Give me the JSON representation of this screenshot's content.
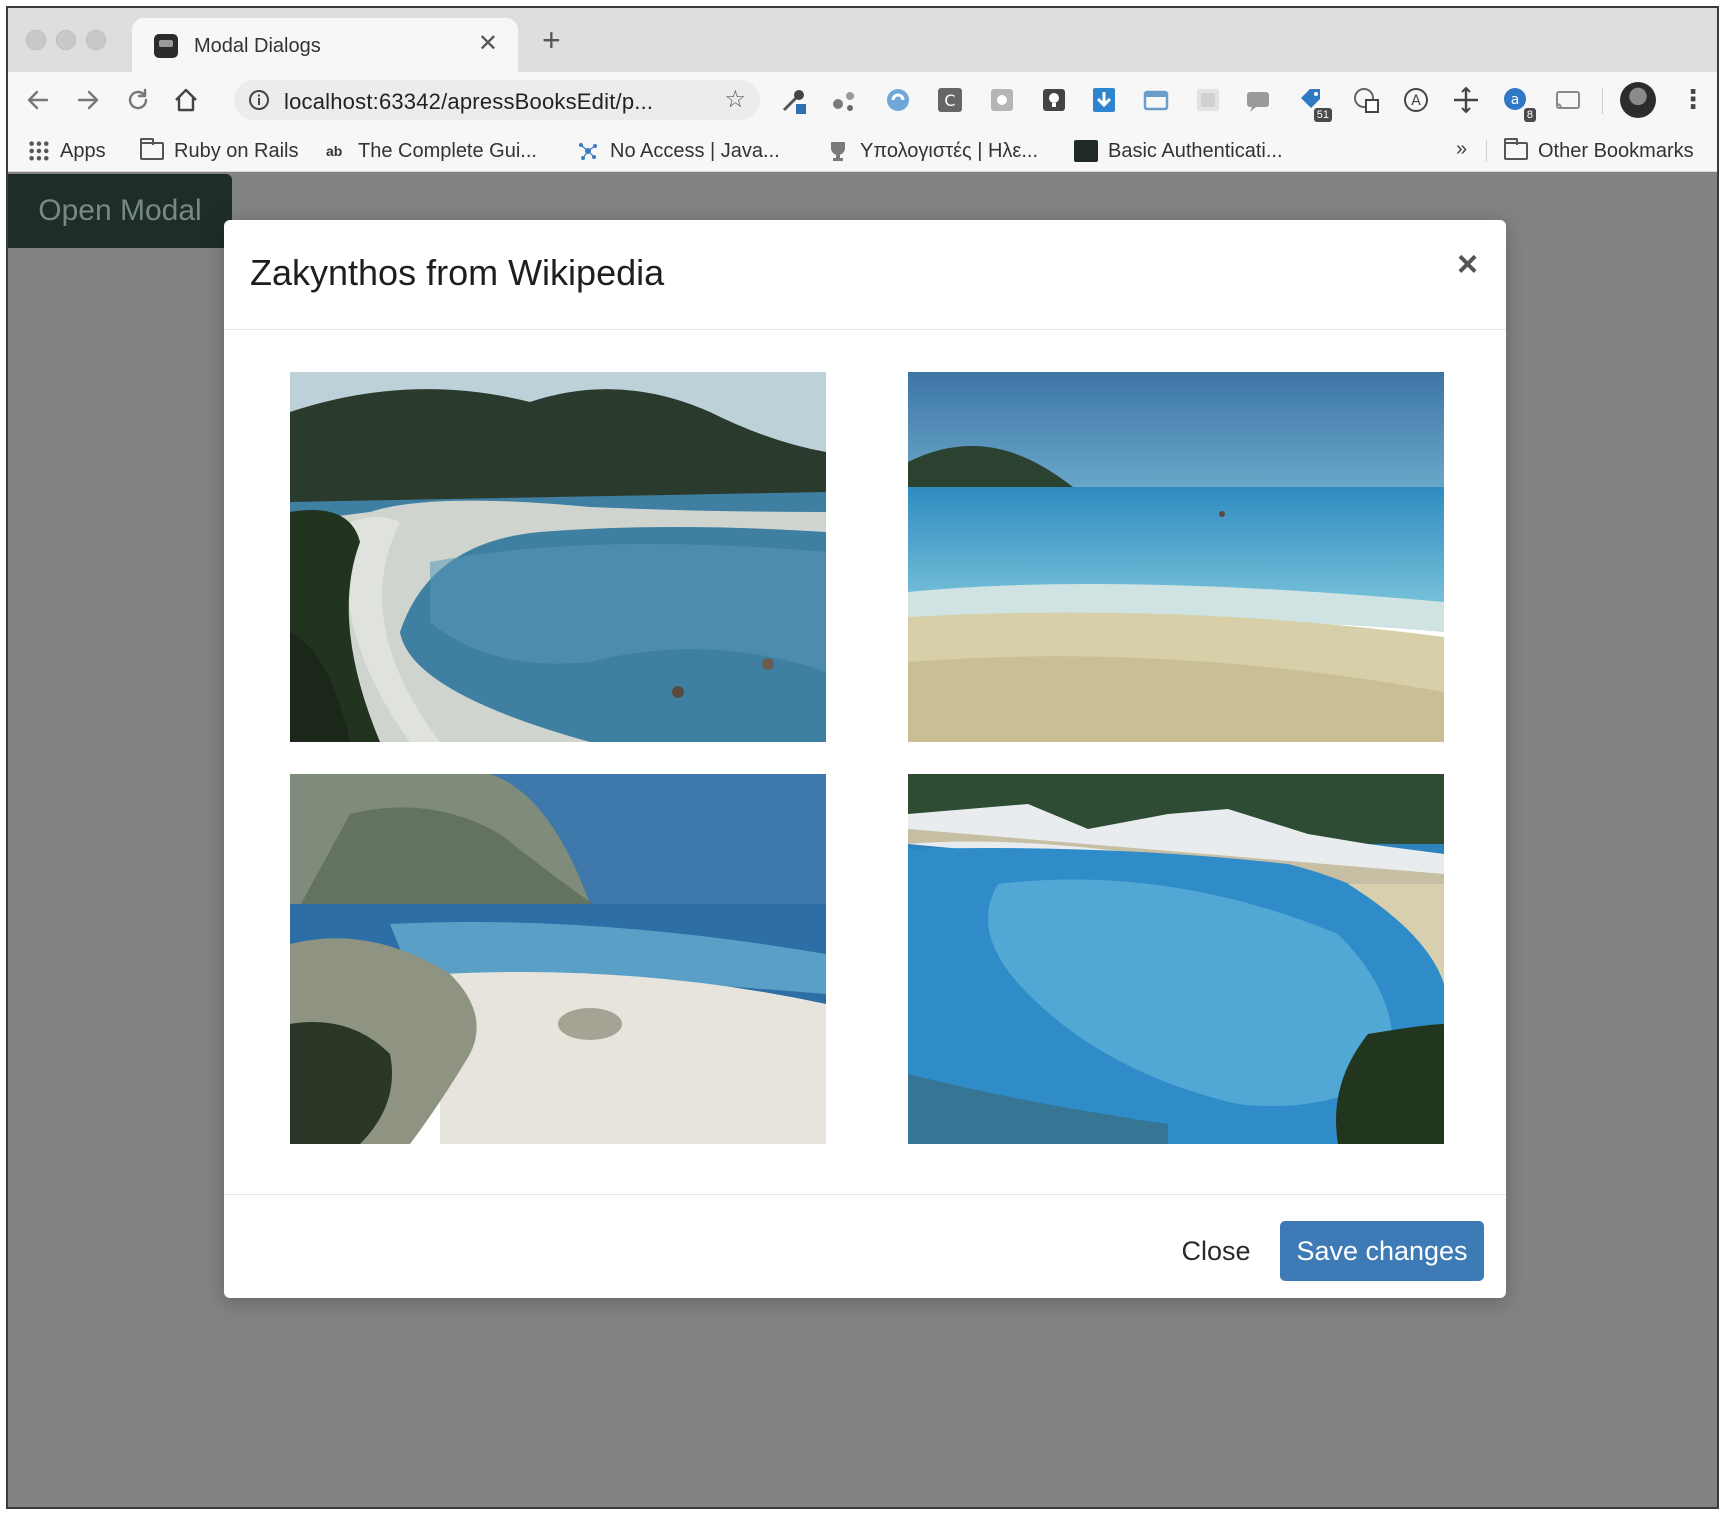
{
  "browser": {
    "tab_title": "Modal Dialogs",
    "url": "localhost:63342/apressBooksEdit/p...",
    "extension_badges": [
      "51",
      "8"
    ],
    "bookmarks": [
      {
        "label": "Apps",
        "icon": "apps-grid-icon"
      },
      {
        "label": "Ruby on Rails",
        "icon": "folder-icon"
      },
      {
        "label": "The Complete Gui...",
        "icon": "ab-icon"
      },
      {
        "label": "No Access | Java...",
        "icon": "molecule-icon"
      },
      {
        "label": "Υπολογιστές | Ηλε...",
        "icon": "trophy-icon"
      },
      {
        "label": "Basic Authenticati...",
        "icon": "dark-square-icon"
      }
    ],
    "bookmarks_overflow": "»",
    "other_bookmarks": "Other Bookmarks"
  },
  "page": {
    "open_modal_label": "Open Modal"
  },
  "modal": {
    "title": "Zakynthos from Wikipedia",
    "close_symbol": "×",
    "close_label": "Close",
    "save_label": "Save changes",
    "images": [
      {
        "name": "cove-beach-photo"
      },
      {
        "name": "open-sea-beach-photo"
      },
      {
        "name": "rocky-cliff-beach-photo"
      },
      {
        "name": "village-bay-photo"
      }
    ]
  },
  "colors": {
    "primary": "#3e7ab6",
    "backdrop": "#838383",
    "open_modal_bg": "#1f2d28"
  }
}
